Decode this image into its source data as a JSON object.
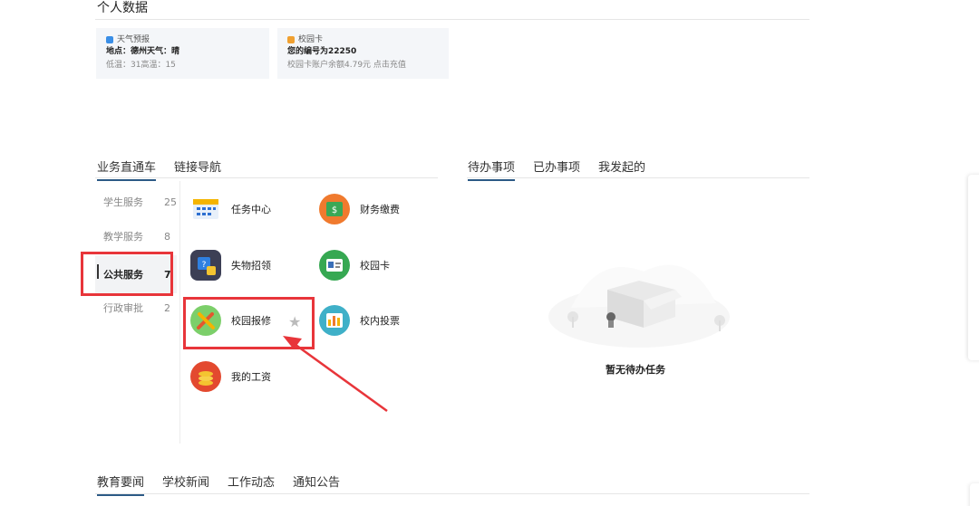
{
  "personal": {
    "title": "个人数据",
    "weather": {
      "label": "天气预报",
      "line2": "地点：德州天气：晴",
      "line3": "低温：31高温：15"
    },
    "card": {
      "label": "校园卡",
      "line2": "您的编号为22250",
      "line3": "校园卡账户余额4.79元  点击充值"
    }
  },
  "service_tabs": [
    "业务直通车",
    "链接导航"
  ],
  "todo_tabs": [
    "待办事项",
    "已办事项",
    "我发起的"
  ],
  "news_tabs": [
    "教育要闻",
    "学校新闻",
    "工作动态",
    "通知公告"
  ],
  "categories": [
    {
      "label": "学生服务",
      "count": "25"
    },
    {
      "label": "教学服务",
      "count": "8"
    },
    {
      "label": "公共服务",
      "count": "7"
    },
    {
      "label": "行政审批",
      "count": "2"
    }
  ],
  "services": [
    {
      "label": "任务中心",
      "icon": "calendar-icon"
    },
    {
      "label": "财务缴费",
      "icon": "money-icon"
    },
    {
      "label": "失物招领",
      "icon": "lost-found-icon"
    },
    {
      "label": "校园卡",
      "icon": "id-card-icon"
    },
    {
      "label": "校园报修",
      "icon": "repair-tools-icon"
    },
    {
      "label": "校内投票",
      "icon": "bar-chart-icon"
    },
    {
      "label": "我的工资",
      "icon": "coins-icon"
    }
  ],
  "empty_text": "暂无待办任务",
  "colors": {
    "accent": "#2c5a86",
    "highlight": "#e8353a"
  }
}
